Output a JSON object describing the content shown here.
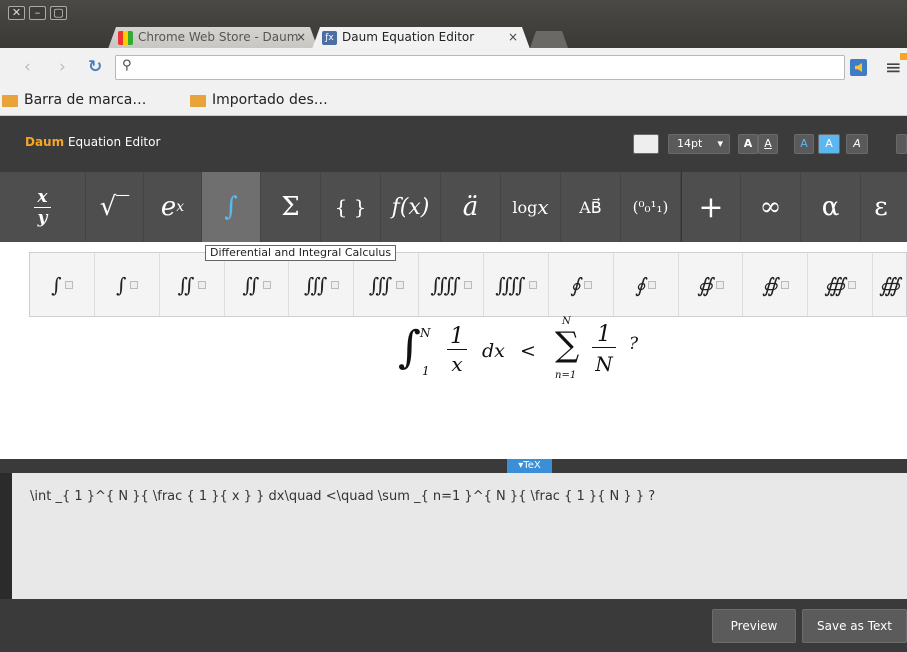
{
  "window": {
    "close": "✕",
    "minimize": "–",
    "maximize": "▢"
  },
  "tabs": [
    {
      "label": "Chrome Web Store - Daum",
      "close": "×"
    },
    {
      "label": "Daum Equation Editor",
      "close": "×"
    }
  ],
  "bookmarks": [
    "Barra de marca…",
    "Importado des…"
  ],
  "editor": {
    "brand": "Daum",
    "title": "Equation Editor",
    "font_size": "14pt",
    "style_buttons": [
      "A",
      "A",
      "A",
      "A",
      "A"
    ]
  },
  "symbols": [
    {
      "name": "fraction",
      "glyph": "x/y"
    },
    {
      "name": "root",
      "glyph": "√‾"
    },
    {
      "name": "exponent",
      "glyph": "eˣ"
    },
    {
      "name": "integral",
      "glyph": "∫"
    },
    {
      "name": "sum",
      "glyph": "Σ"
    },
    {
      "name": "braces",
      "glyph": "{ }"
    },
    {
      "name": "function",
      "glyph": "f(x)"
    },
    {
      "name": "accent",
      "glyph": "ä"
    },
    {
      "name": "log",
      "glyph": "log x"
    },
    {
      "name": "vector",
      "glyph": "AB⃗"
    },
    {
      "name": "matrix",
      "glyph": "(1 0 / 0 1)"
    },
    {
      "name": "plus",
      "glyph": "+"
    },
    {
      "name": "infinity",
      "glyph": "∞"
    },
    {
      "name": "alpha",
      "glyph": "α"
    },
    {
      "name": "epsilon",
      "glyph": "ε"
    }
  ],
  "tooltip": "Differential and Integral Calculus",
  "integrals": [
    "∫",
    "∫",
    "∬",
    "∬",
    "∭",
    "∭",
    "⨌",
    "⨌",
    "∮",
    "∮",
    "∯",
    "∯",
    "∰",
    "∰"
  ],
  "formula": {
    "upper": "N",
    "lower": "1",
    "numer": "1",
    "denom": "x",
    "dx": "dx",
    "lt": "<",
    "sum_upper": "N",
    "sum_lower": "n=1",
    "numer2": "1",
    "denom2": "N",
    "q": "?"
  },
  "tex_toggle": "▾TeX",
  "tex": "\\int _{ 1 }^{ N }{ \\frac { 1 }{ x } } dx\\quad <\\quad \\sum _{ n=1 }^{ N }{ \\frac { 1 }{ N } } ?",
  "footer": {
    "preview": "Preview",
    "save": "Save as Text"
  }
}
